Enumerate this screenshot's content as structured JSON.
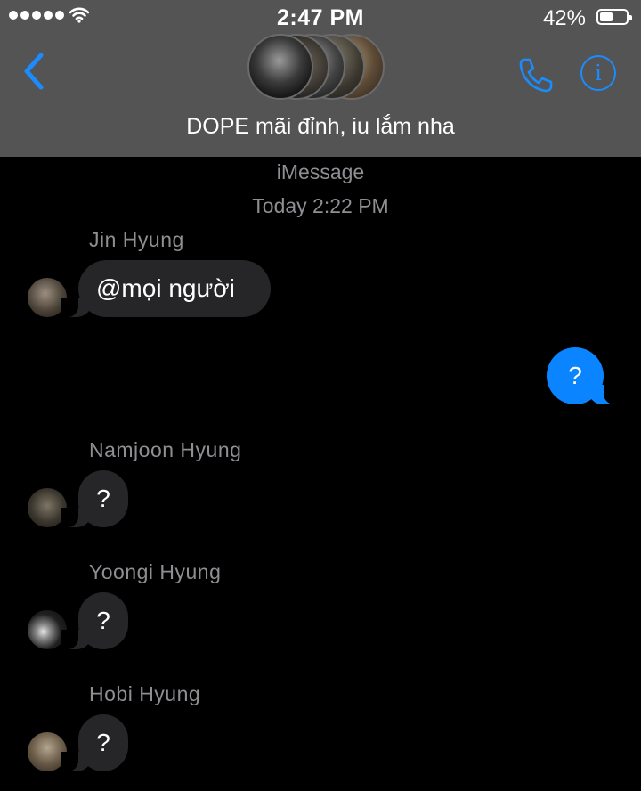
{
  "status_bar": {
    "time": "2:47 PM",
    "battery_percent": "42%",
    "battery_level": 0.42,
    "signal_bars": 5
  },
  "header": {
    "group_name": "DOPE mãi đỉnh, iu lắm nha",
    "back_icon": "chevron-left-icon",
    "call_icon": "phone-icon",
    "info_icon": "info-icon",
    "info_glyph": "i",
    "accent_color": "#1a8cff"
  },
  "conversation": {
    "service_label": "iMessage",
    "timestamp": "Today 2:22 PM",
    "messages": [
      {
        "sender": "Jin Hyung",
        "text": "@mọi người",
        "direction": "incoming"
      },
      {
        "sender": "",
        "text": "?",
        "direction": "outgoing"
      },
      {
        "sender": "Namjoon Hyung",
        "text": "?",
        "direction": "incoming"
      },
      {
        "sender": "Yoongi Hyung",
        "text": "?",
        "direction": "incoming"
      },
      {
        "sender": "Hobi Hyung",
        "text": "?",
        "direction": "incoming"
      }
    ]
  },
  "colors": {
    "header_bg": "#545454",
    "incoming_bubble": "#262628",
    "outgoing_bubble": "#0a84ff",
    "meta_text": "#8e8e93"
  }
}
